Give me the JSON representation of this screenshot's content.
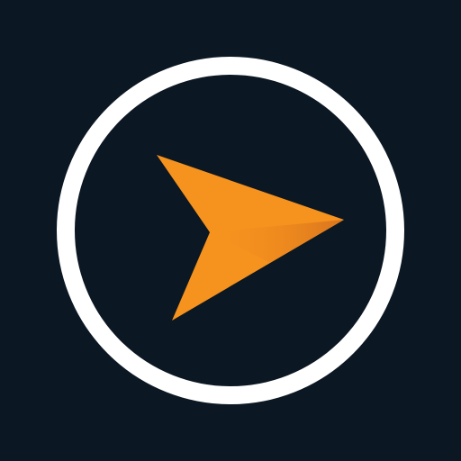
{
  "icon": {
    "name": "navigation-arrow-in-circle",
    "colors": {
      "background": "#0b1722",
      "ring": "#ffffff",
      "arrow_primary": "#f6921e",
      "arrow_shade": "#d9741e"
    }
  }
}
